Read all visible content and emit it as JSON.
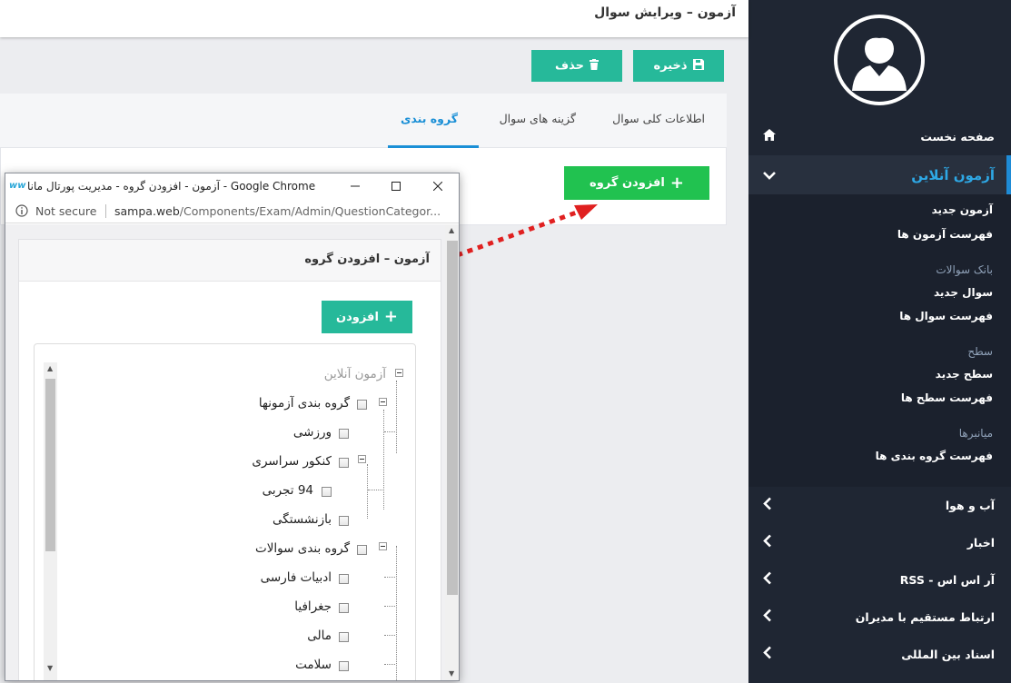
{
  "page": {
    "title": "آزمون – ویرایش سوال",
    "save_label": "ذخیره",
    "delete_label": "حذف",
    "tabs": [
      {
        "label": "اطلاعات کلی سوال"
      },
      {
        "label": "گزینه های سوال"
      },
      {
        "label": "گروه بندی"
      }
    ],
    "add_group_label": "افزودن گروه"
  },
  "sidebar": {
    "home": "صفحه نخست",
    "online_exam": "آزمون آنلاین",
    "sections": [
      {
        "heading": "",
        "links": [
          "آزمون جدید",
          "فهرست آزمون ها"
        ]
      },
      {
        "heading": "بانک سوالات",
        "links": [
          "سوال جدید",
          "فهرست سوال ها"
        ]
      },
      {
        "heading": "سطح",
        "links": [
          "سطح جدید",
          "فهرست سطح ها"
        ]
      },
      {
        "heading": "میانبرها",
        "links": [
          "فهرست گروه بندی ها"
        ]
      }
    ],
    "items": [
      "آب و هوا",
      "اخبار",
      "آر اس اس - RSS",
      "ارتباط مستقیم با مدیران",
      "اسناد بین المللی"
    ]
  },
  "popup": {
    "window_title": "آزمون - افزودن گروه - مدیریت پورتال مانا - Google Chrome",
    "not_secure": "Not secure",
    "url_host": "sampa.web",
    "url_path": "/Components/Exam/Admin/QuestionCategor...",
    "card_title": "آزمون – افزودن گروه",
    "add_label": "افزودن",
    "tree": [
      {
        "label": "آزمون آنلاین"
      },
      {
        "label": "گروه بندی آزمونها"
      },
      {
        "label": "ورزشی"
      },
      {
        "label": "کنکور سراسری"
      },
      {
        "label": "94 تجربی"
      },
      {
        "label": "بازنشستگی"
      },
      {
        "label": "گروه بندی سوالات"
      },
      {
        "label": "ادبیات فارسی"
      },
      {
        "label": "جغرافیا"
      },
      {
        "label": "مالی"
      },
      {
        "label": "سلامت"
      }
    ]
  },
  "colors": {
    "sidebar": "#1f2633",
    "teal": "#26b99a",
    "green": "#21c250",
    "accent_blue": "#1a8fd6",
    "arrow_red": "#e02020"
  }
}
